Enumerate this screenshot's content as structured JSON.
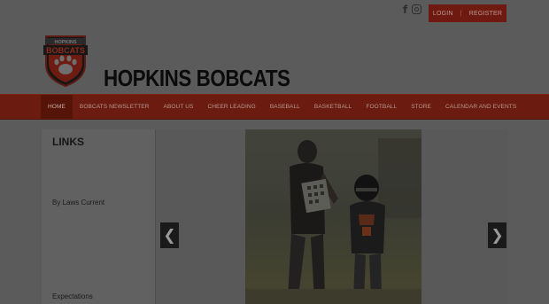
{
  "topbar": {
    "social": [
      {
        "name": "facebook-icon",
        "glyph": "f"
      },
      {
        "name": "instagram-icon"
      }
    ],
    "login_label": "LOGIN",
    "separator": "|",
    "register_label": "REGISTER"
  },
  "header": {
    "site_title": "HOPKINS BOBCATS",
    "logo_text_top": "HOPKINS",
    "logo_text_main": "BOBCATS"
  },
  "nav": {
    "items": [
      {
        "label": "HOME",
        "active": true
      },
      {
        "label": "BOBCATS NEWSLETTER"
      },
      {
        "label": "ABOUT US"
      },
      {
        "label": "CHEER LEADING"
      },
      {
        "label": "BASEBALL"
      },
      {
        "label": "BASKETBALL"
      },
      {
        "label": "FOOTBALL"
      },
      {
        "label": "STORE"
      },
      {
        "label": "CALENDAR AND EVENTS"
      }
    ]
  },
  "links": {
    "title": "LINKS",
    "items": [
      "By Laws Current",
      "Expectations"
    ]
  },
  "slider": {
    "prev_glyph": "❮",
    "next_glyph": "❯"
  },
  "colors": {
    "nav_bg": "#6b1b10",
    "overlay": "#5b5b5b",
    "accent": "#d13a1f"
  }
}
